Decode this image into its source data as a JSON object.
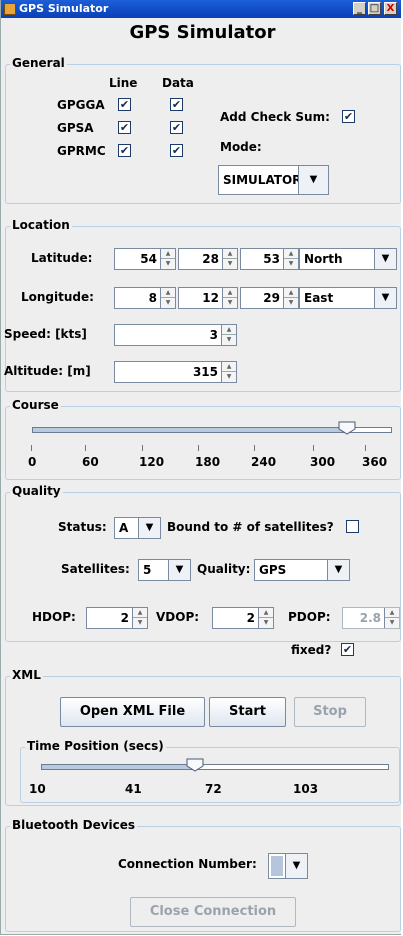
{
  "window": {
    "title": "GPS Simulator",
    "minimize": "_",
    "maximize": "□",
    "close": "X"
  },
  "app_title": "GPS Simulator",
  "general": {
    "legend": "General",
    "col_line": "Line",
    "col_data": "Data",
    "rows": [
      {
        "label": "GPGGA",
        "line": true,
        "data": true
      },
      {
        "label": "GPSA",
        "line": true,
        "data": true
      },
      {
        "label": "GPRMC",
        "line": true,
        "data": true
      }
    ],
    "add_checksum_label": "Add Check Sum:",
    "add_checksum": true,
    "mode_label": "Mode:",
    "mode_value": "SIMULATOR"
  },
  "location": {
    "legend": "Location",
    "latitude_label": "Latitude:",
    "latitude": {
      "deg": "54",
      "min": "28",
      "sec": "53",
      "hemisphere": "North"
    },
    "longitude_label": "Longitude:",
    "longitude": {
      "deg": "8",
      "min": "12",
      "sec": "29",
      "hemisphere": "East"
    },
    "speed_label": "Speed: [kts]",
    "speed": "3",
    "altitude_label": "Altitude: [m]",
    "altitude": "315"
  },
  "course": {
    "legend": "Course",
    "value": 315,
    "min": 0,
    "max": 360,
    "tick_labels": [
      "0",
      "60",
      "120",
      "180",
      "240",
      "300",
      "360"
    ]
  },
  "quality": {
    "legend": "Quality",
    "status_label": "Status:",
    "status_value": "A",
    "bound_label": "Bound to # of satellites?",
    "bound": false,
    "satellites_label": "Satellites:",
    "satellites_value": "5",
    "quality_label": "Quality:",
    "quality_value": "GPS",
    "hdop_label": "HDOP:",
    "hdop": "2",
    "vdop_label": "VDOP:",
    "vdop": "2",
    "pdop_label": "PDOP:",
    "pdop": "2.8",
    "fixed_label": "fixed?",
    "fixed": true
  },
  "xml": {
    "legend": "XML",
    "open_label": "Open XML File",
    "start_label": "Start",
    "stop_label": "Stop",
    "time_legend": "Time Position (secs)",
    "time_value": 65,
    "time_min": 10,
    "time_max": 134,
    "tick_labels": [
      "10",
      "41",
      "72",
      "103"
    ]
  },
  "bluetooth": {
    "legend": "Bluetooth Devices",
    "connection_label": "Connection Number:",
    "connection_value": "",
    "close_label": "Close Connection"
  }
}
